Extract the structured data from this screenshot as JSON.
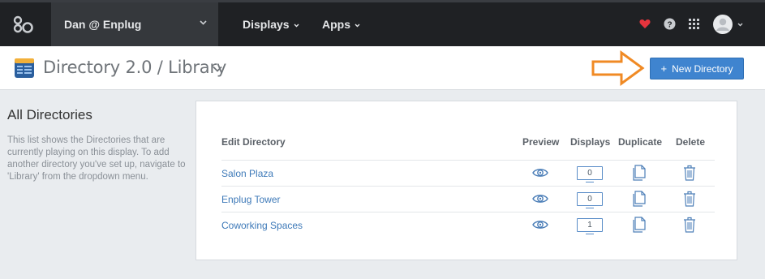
{
  "topbar": {
    "account_label": "Dan @ Enplug",
    "nav": [
      {
        "label": "Displays"
      },
      {
        "label": "Apps"
      }
    ]
  },
  "subheader": {
    "title": "Directory 2.0 / Library",
    "new_button": {
      "plus": "+",
      "label": "New Directory"
    }
  },
  "sidebar": {
    "title": "All Directories",
    "description": "This list shows the Directories that are currently playing on this display. To add another directory you've set up, navigate to 'Library' from the dropdown menu."
  },
  "table": {
    "columns": {
      "name": "Edit Directory",
      "preview": "Preview",
      "displays": "Displays",
      "duplicate": "Duplicate",
      "delete": "Delete"
    },
    "rows": [
      {
        "name": "Salon Plaza",
        "displays": "0"
      },
      {
        "name": "Enplug Tower",
        "displays": "0"
      },
      {
        "name": "Coworking Spaces",
        "displays": "1"
      }
    ]
  },
  "colors": {
    "topbar": "#1f2124",
    "accent_blue": "#3f84cf",
    "link_blue": "#3d79b8",
    "heart_red": "#e5343d",
    "arrow_orange": "#f08a24"
  },
  "icons": [
    "enplug-logo-icon",
    "heart-icon",
    "help-icon",
    "apps-grid-icon",
    "avatar-icon",
    "eye-icon",
    "monitor-icon",
    "duplicate-icon",
    "trash-icon",
    "directory-app-icon",
    "arrow-annotation-icon"
  ]
}
